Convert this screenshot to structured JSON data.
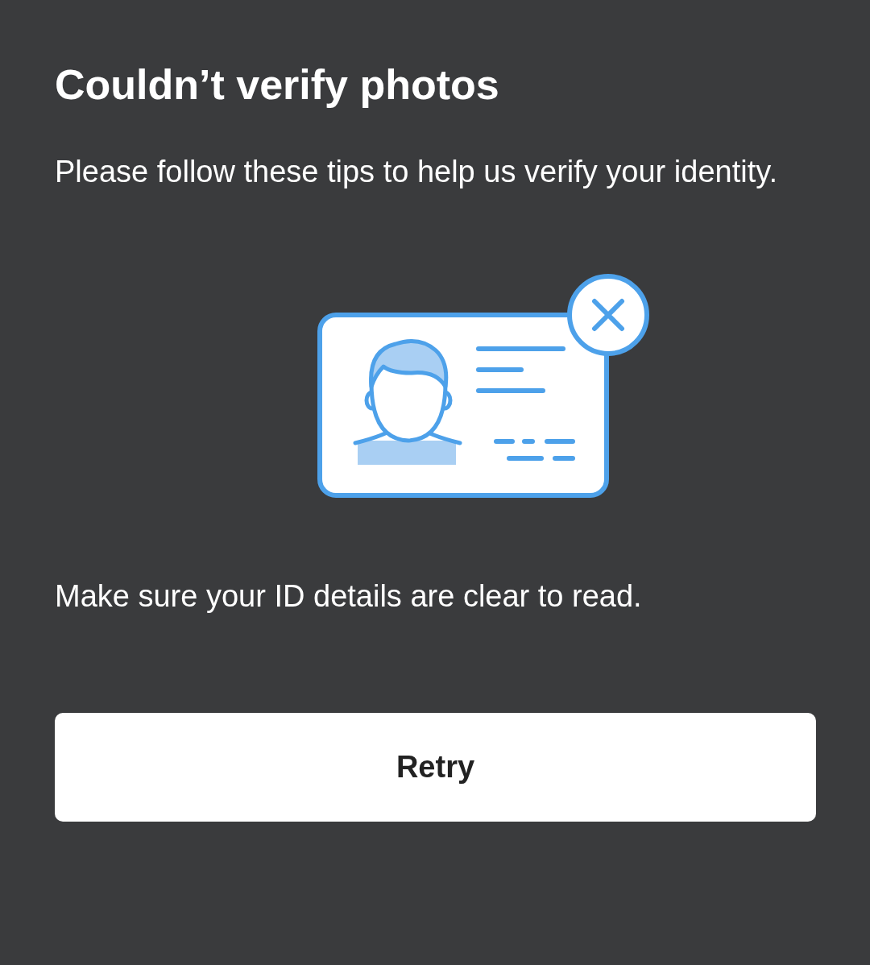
{
  "title": "Couldn’t verify photos",
  "intro": "Please follow these tips to help us verify your identity.",
  "illustration": {
    "kind": "id-card-error"
  },
  "tip": "Make sure your ID details are clear to read.",
  "button": {
    "label": "Retry"
  }
}
